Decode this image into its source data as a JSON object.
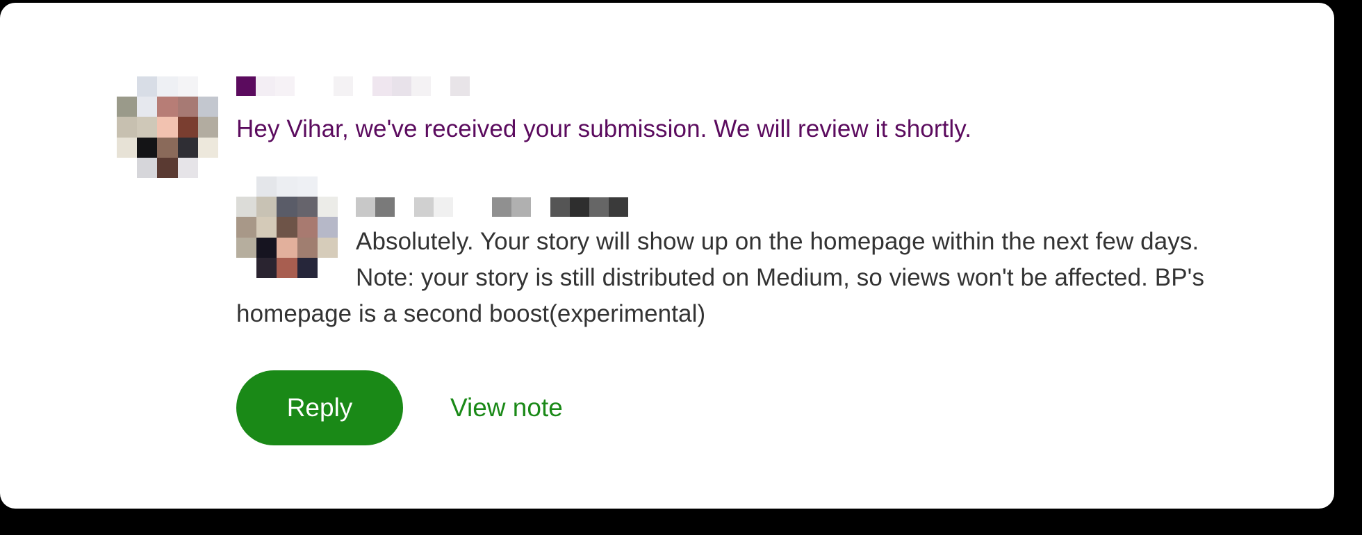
{
  "notification": {
    "message": "Hey Vihar, we've received your submission. We will review it shortly.",
    "reply": {
      "message": "Absolutely. Your story will show up on the homepage within the next few days. Note: your story is still distributed on Medium, so views won't be affected. BP's homepage is a second boost(experimental)"
    }
  },
  "actions": {
    "reply_label": "Reply",
    "view_note_label": "View note"
  },
  "colors": {
    "sender_message": "#5b0b5e",
    "reply_message": "#333333",
    "accent_green": "#1a8917",
    "background": "#ffffff",
    "frame": "#000000"
  },
  "avatars": {
    "sender_pixels": [
      "#ffffff",
      "#d8dde6",
      "#eef0f4",
      "#f4f4f6",
      "#ffffff",
      "#9a9a8a",
      "#e6e8ee",
      "#b77d76",
      "#a77a74",
      "#c3c7cf",
      "#c7c0b0",
      "#cfc8b8",
      "#f2c2b0",
      "#7a3e30",
      "#b2aca0",
      "#e7e2d6",
      "#141416",
      "#8a6a5a",
      "#2f2e34",
      "#ede8dc",
      "#ffffff",
      "#d6d6da",
      "#5a3a32",
      "#e6e4e8",
      "#ffffff"
    ],
    "reply_pixels": [
      "#ffffff",
      "#e4e6ea",
      "#eceef2",
      "#eef0f4",
      "#ffffff",
      "#dcdcd8",
      "#c8c2b4",
      "#5a5c68",
      "#66646c",
      "#ecece8",
      "#a89888",
      "#d4cab8",
      "#6e5448",
      "#a87a70",
      "#b6b8c8",
      "#b6ae9e",
      "#161420",
      "#e2b09c",
      "#a07e70",
      "#d6ccba",
      "#ffffff",
      "#2a2430",
      "#a85e50",
      "#26263a",
      "#ffffff"
    ],
    "sender_name_pixels": [
      "#5b0b5e",
      "#f3eef4",
      "#f6f2f6",
      "#ffffff",
      "#ffffff",
      "#f4f2f4",
      "#ffffff",
      "#efe6ef",
      "#e8e2ea",
      "#f4f2f4",
      "#ffffff",
      "#e8e4e8"
    ],
    "reply_name_pixels": [
      "#c8c8c8",
      "#7a7a7a",
      "#ffffff",
      "#d0d0d0",
      "#f0f0f0",
      "#ffffff",
      "#ffffff",
      "#909090",
      "#b0b0b0",
      "#ffffff",
      "#555555",
      "#2e2e2e",
      "#666666",
      "#3a3a3a"
    ]
  }
}
